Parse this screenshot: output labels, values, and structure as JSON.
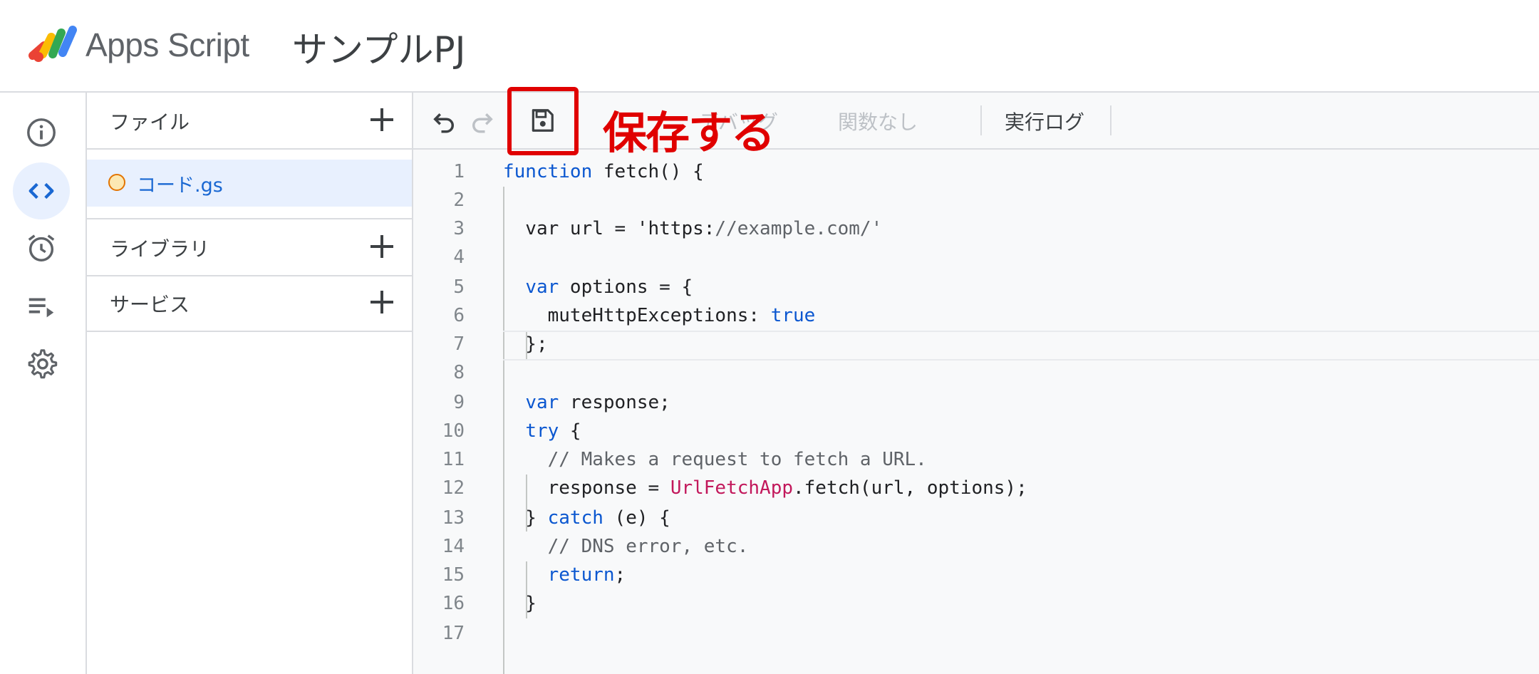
{
  "header": {
    "app_name": "Apps Script",
    "project_name": "サンプルPJ"
  },
  "rail": {
    "items": [
      {
        "icon": "info-icon"
      },
      {
        "icon": "code-icon",
        "active": true
      },
      {
        "icon": "alarm-clock-icon"
      },
      {
        "icon": "executions-icon"
      },
      {
        "icon": "gear-icon"
      }
    ]
  },
  "files_panel": {
    "files_title": "ファイル",
    "files": [
      {
        "name": "コード.gs"
      }
    ],
    "libraries_title": "ライブラリ",
    "services_title": "サービス"
  },
  "toolbar": {
    "annotation": "保存する",
    "debug_label": "デバッグ",
    "function_select": "関数なし",
    "execution_log": "実行ログ"
  },
  "code": {
    "lines": [
      "function fetch() {",
      "",
      "  var url = 'https://example.com/'",
      "",
      "  var options = {",
      "    muteHttpExceptions: true",
      "  };",
      "",
      "  var response;",
      "  try {",
      "    // Makes a request to fetch a URL.",
      "    response = UrlFetchApp.fetch(url, options);",
      "  } catch (e) {",
      "    // DNS error, etc.",
      "    return;",
      "  }",
      ""
    ]
  },
  "colors": {
    "keyword": "#0b57d0",
    "string": "#a50e0e",
    "class": "#c2185b",
    "annotation": "#e00000",
    "active_bg": "#e8f0fe"
  }
}
